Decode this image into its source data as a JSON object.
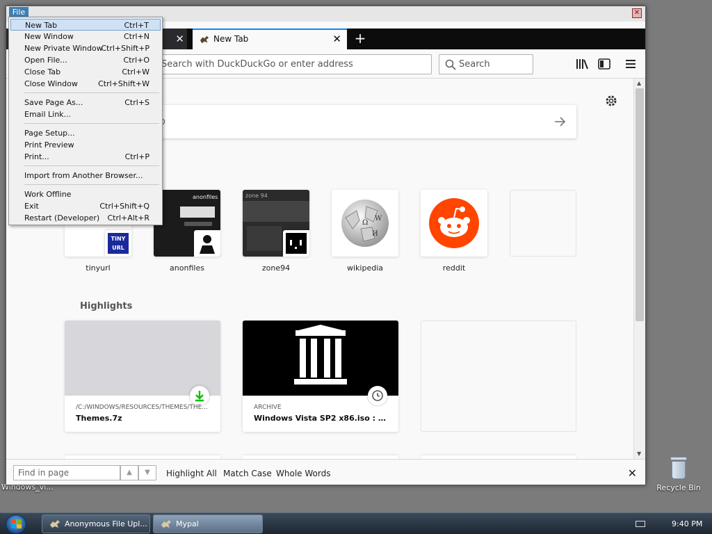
{
  "desktop": {
    "recycle_bin_label": "Recycle Bin",
    "left_icon_label": "Windows_vi..."
  },
  "window": {
    "menu_file": "File"
  },
  "tabs": [
    {
      "label": "",
      "close": "✕"
    },
    {
      "label": "New Tab",
      "close": "✕"
    }
  ],
  "new_tab_symbol": "+",
  "navbar": {
    "url_placeholder": "Search with DuckDuckGo or enter address",
    "search_placeholder": "Search"
  },
  "newtab": {
    "search_placeholder_partial": "b",
    "top_sites": [
      {
        "label": "tinyurl"
      },
      {
        "label": "anonfiles"
      },
      {
        "label": "zone94"
      },
      {
        "label": "wikipedia"
      },
      {
        "label": "reddit"
      },
      {
        "label": ""
      }
    ],
    "highlights_heading": "Highlights",
    "highlights": [
      {
        "context": "/C:/WINDOWS/RESOURCES/THEMES/THE...",
        "title": "Themes.7z"
      },
      {
        "context": "ARCHIVE",
        "title": "Windows Vista SP2 x86.iso : Micr..."
      }
    ],
    "tinyurl_mini_text_1": "TINY",
    "tinyurl_mini_text_2": "URL",
    "anonfiles_thumb_text": "anonfiles",
    "zone94_thumb_text": "zone 94"
  },
  "findbar": {
    "placeholder": "Find in page",
    "highlight_all": "Highlight All",
    "match_case": "Match Case",
    "whole_words": "Whole Words",
    "close": "✕"
  },
  "file_menu": {
    "items": [
      {
        "label": "New Tab",
        "shortcut": "Ctrl+T"
      },
      {
        "label": "New Window",
        "shortcut": "Ctrl+N"
      },
      {
        "label": "New Private Window",
        "shortcut": "Ctrl+Shift+P"
      },
      {
        "label": "Open File...",
        "shortcut": "Ctrl+O"
      },
      {
        "label": "Close Tab",
        "shortcut": "Ctrl+W"
      },
      {
        "label": "Close Window",
        "shortcut": "Ctrl+Shift+W"
      },
      {
        "label": "Save Page As...",
        "shortcut": "Ctrl+S"
      },
      {
        "label": "Email Link...",
        "shortcut": ""
      },
      {
        "label": "Page Setup...",
        "shortcut": ""
      },
      {
        "label": "Print Preview",
        "shortcut": ""
      },
      {
        "label": "Print...",
        "shortcut": "Ctrl+P"
      },
      {
        "label": "Import from Another Browser...",
        "shortcut": ""
      },
      {
        "label": "Work Offline",
        "shortcut": ""
      },
      {
        "label": "Exit",
        "shortcut": "Ctrl+Shift+Q"
      },
      {
        "label": "Restart (Developer)",
        "shortcut": "Ctrl+Alt+R"
      }
    ]
  },
  "taskbar": {
    "tasks": [
      {
        "label": "Anonymous File Upl..."
      },
      {
        "label": "Mypal"
      }
    ],
    "clock": "9:40 PM"
  },
  "colors": {
    "accent": "#0a84ff",
    "reddit": "#ff4500",
    "tab_dark": "#0c0c0d"
  }
}
